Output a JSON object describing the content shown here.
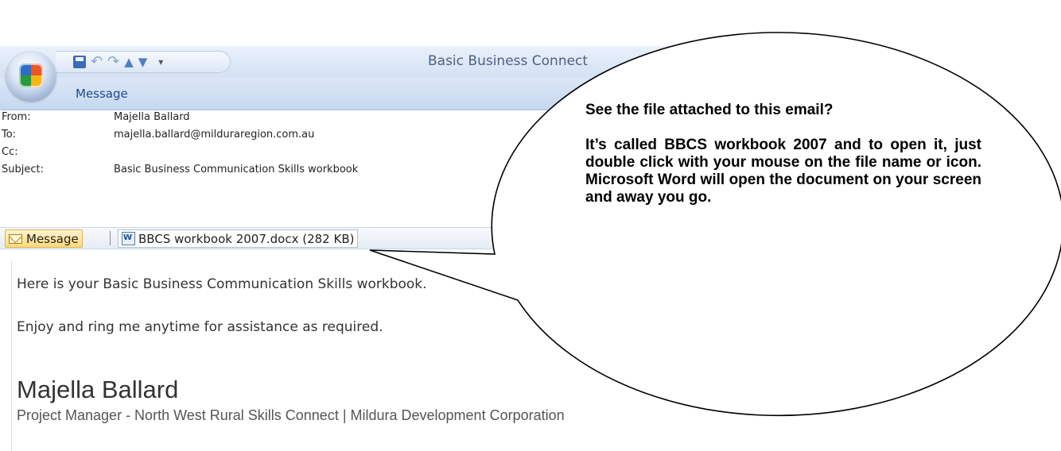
{
  "window": {
    "title": "Basic Business Connect",
    "ribbon_tab": "Message",
    "quick_access": {
      "save_icon": "save-icon",
      "undo_icon": "undo-icon",
      "redo_icon": "redo-icon",
      "up_icon": "previous-item-icon",
      "down_icon": "next-item-icon",
      "more_icon": "customize-toolbar-icon"
    }
  },
  "headers": {
    "from_label": "From:",
    "from_value": "Majella Ballard",
    "to_label": "To:",
    "to_value": "majella.ballard@milduraregion.com.au",
    "cc_label": "Cc:",
    "cc_value": "",
    "subject_label": "Subject:",
    "subject_value": "Basic Business Communication Skills workbook"
  },
  "attachments": {
    "message_tab": "Message",
    "file": "BBCS workbook 2007.docx (282 KB)"
  },
  "body": {
    "line1": "Here is your Basic Business Communication Skills workbook.",
    "line2": "Enjoy and ring me anytime for assistance as required.",
    "signature_name": "Majella Ballard",
    "signature_title": "Project Manager - North West Rural Skills Connect | Mildura Development Corporation"
  },
  "callout": {
    "question": "See the file attached to this email?",
    "paragraph": "It’s called BBCS workbook 2007 and to open it, just double click with your mouse on the file name or icon.  Microsoft Word will open the document on your screen and away you go."
  }
}
